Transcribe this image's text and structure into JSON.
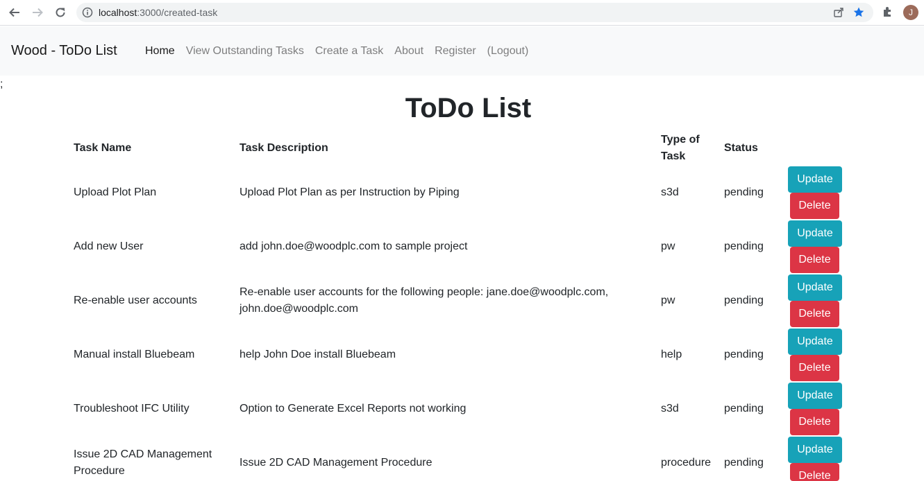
{
  "browser": {
    "url_host": "localhost",
    "url_path": ":3000/created-task",
    "avatar_letter": "J"
  },
  "navbar": {
    "brand": "Wood - ToDo List",
    "links": [
      {
        "label": "Home",
        "active": true
      },
      {
        "label": "View Outstanding Tasks",
        "active": false
      },
      {
        "label": "Create a Task",
        "active": false
      },
      {
        "label": "About",
        "active": false
      },
      {
        "label": "Register",
        "active": false
      },
      {
        "label": "(Logout)",
        "active": false
      }
    ]
  },
  "stray_text": ";",
  "page": {
    "title": "ToDo List"
  },
  "table": {
    "headers": {
      "name": "Task Name",
      "description": "Task Description",
      "type": "Type of Task",
      "status": "Status"
    },
    "rows": [
      {
        "name": "Upload Plot Plan",
        "description": "Upload Plot Plan as per Instruction by Piping",
        "type": "s3d",
        "status": "pending"
      },
      {
        "name": "Add new User",
        "description": "add john.doe@woodplc.com to sample project",
        "type": "pw",
        "status": "pending"
      },
      {
        "name": "Re-enable user accounts",
        "description": "Re-enable user accounts for the following people: jane.doe@woodplc.com, john.doe@woodplc.com",
        "type": "pw",
        "status": "pending"
      },
      {
        "name": "Manual install Bluebeam",
        "description": "help John Doe install Bluebeam",
        "type": "help",
        "status": "pending"
      },
      {
        "name": "Troubleshoot IFC Utility",
        "description": "Option to Generate Excel Reports not working",
        "type": "s3d",
        "status": "pending"
      },
      {
        "name": "Issue 2D CAD Management Procedure",
        "description": "Issue 2D CAD Management Procedure",
        "type": "procedure",
        "status": "pending"
      }
    ],
    "update_label": "Update",
    "delete_label": "Delete"
  }
}
